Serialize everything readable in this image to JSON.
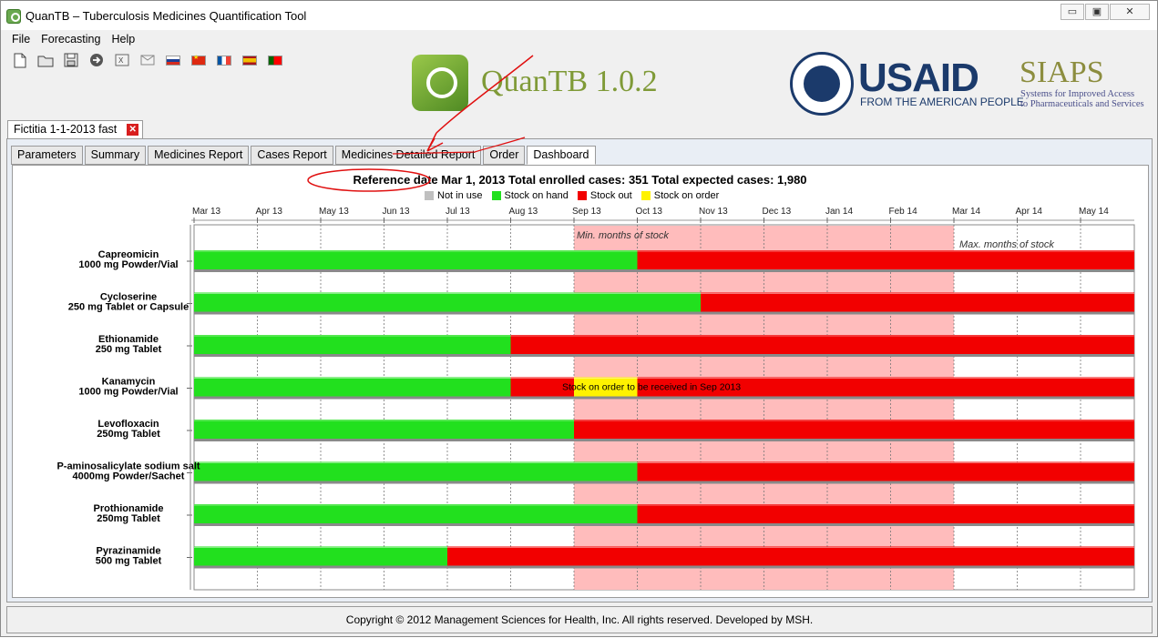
{
  "window": {
    "title": "QuanTB – Tuberculosis Medicines Quantification Tool",
    "minimize": "▭",
    "restore": "▣",
    "close": "✕"
  },
  "menu": [
    "File",
    "Forecasting",
    "Help"
  ],
  "toolbar": {
    "icons": [
      "new-file-icon",
      "open-folder-icon",
      "save-icon",
      "arrow-right-icon",
      "export-icon",
      "email-icon"
    ],
    "flags": [
      "flag-ru",
      "flag-cn",
      "flag-fr",
      "flag-es",
      "flag-pt"
    ]
  },
  "branding": {
    "app_logo_text": "QuanTB 1.0.2",
    "usaid_text": "USAID",
    "usaid_subtitle": "FROM THE AMERICAN PEOPLE",
    "siaps_text": "SIAPS",
    "siaps_subtitle_1": "Systems for Improved Access",
    "siaps_subtitle_2": "to Pharmaceuticals and Services"
  },
  "document_tab": {
    "label": "Fictitia 1-1-2013 fast",
    "close": "✕"
  },
  "tabs": [
    "Parameters",
    "Summary",
    "Medicines Report",
    "Cases Report",
    "Medicines Detailed Report",
    "Order",
    "Dashboard"
  ],
  "active_tab": "Dashboard",
  "dashboard": {
    "header": "Reference date Mar 1, 2013 Total enrolled cases: 351 Total expected cases: 1,980",
    "legend": [
      {
        "label": "Not in use",
        "color": "#c0c0c0"
      },
      {
        "label": "Stock on hand",
        "color": "#22e01e"
      },
      {
        "label": "Stock out",
        "color": "#f20000"
      },
      {
        "label": "Stock on order",
        "color": "#fff200"
      }
    ],
    "min_label": "Min. months of stock",
    "max_label": "Max. months of stock",
    "order_text": "Stock on order to be received in Sep 2013"
  },
  "chart_data": {
    "type": "gantt",
    "months": [
      "Mar 13",
      "Apr 13",
      "May 13",
      "Jun 13",
      "Jul 13",
      "Aug 13",
      "Sep 13",
      "Oct 13",
      "Nov 13",
      "Dec 13",
      "Jan 14",
      "Feb 14",
      "Mar 14",
      "Apr 14",
      "May 14"
    ],
    "min_months_of_stock_start": 6,
    "max_months_of_stock_start": 12,
    "medicines": [
      {
        "name": "Capreomicin",
        "form": "1000 mg Powder/Vial",
        "stock_on_hand_months": 7,
        "stock_on_order": null
      },
      {
        "name": "Cycloserine",
        "form": "250 mg Tablet or Capsule",
        "stock_on_hand_months": 8,
        "stock_on_order": null
      },
      {
        "name": "Ethionamide",
        "form": "250 mg Tablet",
        "stock_on_hand_months": 5,
        "stock_on_order": null
      },
      {
        "name": "Kanamycin",
        "form": "1000 mg Powder/Vial",
        "stock_on_hand_months": 5,
        "stock_on_order": {
          "from": 6,
          "to": 7
        }
      },
      {
        "name": "Levofloxacin",
        "form": "250mg Tablet",
        "stock_on_hand_months": 6,
        "stock_on_order": null
      },
      {
        "name": "P-aminosalicylate sodium salt",
        "form": "4000mg Powder/Sachet",
        "stock_on_hand_months": 7,
        "stock_on_order": null
      },
      {
        "name": "Prothionamide",
        "form": "250mg Tablet",
        "stock_on_hand_months": 7,
        "stock_on_order": null
      },
      {
        "name": "Pyrazinamide",
        "form": "500 mg Tablet",
        "stock_on_hand_months": 4,
        "stock_on_order": null
      }
    ]
  },
  "footer": "Copyright © 2012 Management Sciences for Health, Inc. All rights reserved. Developed by MSH."
}
